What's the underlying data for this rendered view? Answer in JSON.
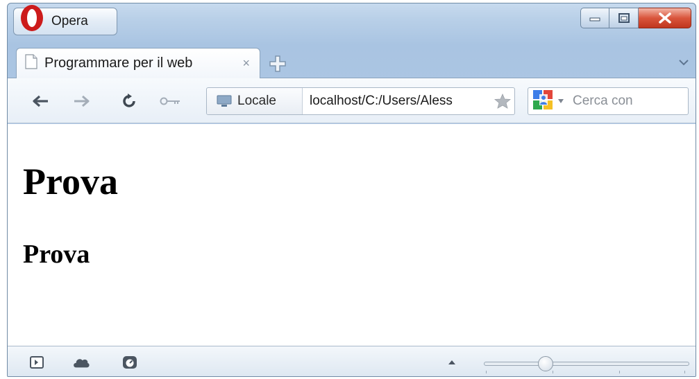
{
  "window": {
    "menu_label": "Opera"
  },
  "tab": {
    "title": "Programmare per il web",
    "close_glyph": "×"
  },
  "address_bar": {
    "badge_label": "Locale",
    "url": "localhost/C:/Users/Aless"
  },
  "search": {
    "placeholder": "Cerca con"
  },
  "page": {
    "heading1": "Prova",
    "heading2": "Prova"
  },
  "zoom": {
    "level_fraction": 0.3
  },
  "colors": {
    "opera_red": "#cc1b1b",
    "close_red": "#c9452c",
    "frame_blue": "#b9d0e8"
  }
}
